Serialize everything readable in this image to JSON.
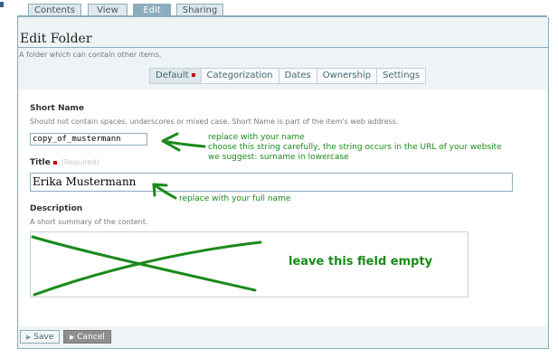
{
  "tabs": [
    {
      "label": "Contents",
      "active": false
    },
    {
      "label": "View",
      "active": false
    },
    {
      "label": "Edit",
      "active": true
    },
    {
      "label": "Sharing",
      "active": false
    }
  ],
  "page": {
    "title": "Edit Folder",
    "description": "A folder which can contain other items."
  },
  "subtabs": [
    {
      "label": "Default",
      "active": true,
      "required": true
    },
    {
      "label": "Categorization",
      "active": false
    },
    {
      "label": "Dates",
      "active": false
    },
    {
      "label": "Ownership",
      "active": false
    },
    {
      "label": "Settings",
      "active": false
    }
  ],
  "fields": {
    "short_name": {
      "label": "Short Name",
      "help": "Should not contain spaces, underscores or mixed case. Short Name is part of the item's web address.",
      "value": "copy_of_mustermann"
    },
    "title": {
      "label": "Title",
      "required_label": "(Required)",
      "value": "Erika Mustermann"
    },
    "description": {
      "label": "Description",
      "help": "A short summary of the content.",
      "value": ""
    }
  },
  "annotations": {
    "short_name_note_1": "replace with your name",
    "short_name_note_2": "choose this string carefully, the string occurs in the URL of your website",
    "short_name_note_3": "we suggest: surname in lowercase",
    "title_note": "replace with your full name",
    "description_note": "leave this field empty",
    "color": "#1a8a1a"
  },
  "buttons": {
    "save": "Save",
    "cancel": "Cancel"
  },
  "colors": {
    "border": "#8cacbb",
    "tab_bg": "#dee7ec",
    "required_marker": "#c00000",
    "annotation": "#1a8a1a"
  }
}
